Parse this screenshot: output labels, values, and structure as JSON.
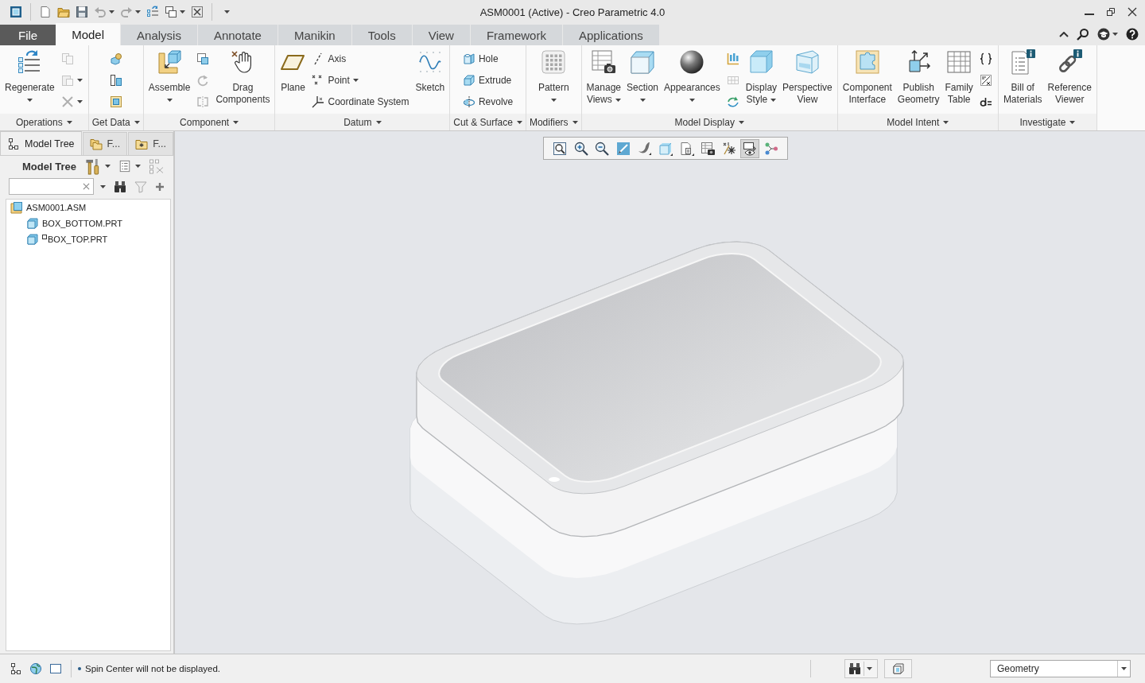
{
  "window": {
    "title": "ASM0001 (Active) - Creo Parametric 4.0"
  },
  "quick_access": [
    {
      "disabled": false,
      "dropdown": false
    },
    {
      "disabled": false,
      "dropdown": false
    },
    {
      "disabled": false,
      "dropdown": false
    },
    {
      "disabled": true,
      "dropdown": true
    },
    {
      "disabled": true,
      "dropdown": true
    },
    {
      "disabled": false,
      "dropdown": false
    },
    {
      "disabled": false,
      "dropdown": true
    },
    {
      "disabled": false,
      "dropdown": false
    }
  ],
  "tabs": [
    {
      "label": "File",
      "kind": "file",
      "selected": false
    },
    {
      "label": "Model",
      "kind": "tab",
      "selected": true
    },
    {
      "label": "Analysis",
      "kind": "tab",
      "selected": false
    },
    {
      "label": "Annotate",
      "kind": "tab",
      "selected": false
    },
    {
      "label": "Manikin",
      "kind": "tab",
      "selected": false
    },
    {
      "label": "Tools",
      "kind": "tab",
      "selected": false
    },
    {
      "label": "View",
      "kind": "tab",
      "selected": false
    },
    {
      "label": "Framework",
      "kind": "tab",
      "selected": false
    },
    {
      "label": "Applications",
      "kind": "tab",
      "selected": false
    }
  ],
  "ribbon": {
    "groups": [
      {
        "label": "Operations",
        "columns": [
          {
            "kind": "large",
            "label": "Regenerate",
            "dropdown": true
          },
          {
            "kind": "stack",
            "items": [
              {
                "disabled": true,
                "dropdown": false
              },
              {
                "disabled": true,
                "dropdown": true
              },
              {
                "disabled": true,
                "dropdown": true
              }
            ]
          }
        ]
      },
      {
        "label": "Get Data",
        "columns": [
          {
            "kind": "stack",
            "items": [
              {
                "disabled": false,
                "dropdown": false
              },
              {
                "disabled": false,
                "dropdown": false
              },
              {
                "disabled": false,
                "dropdown": false
              }
            ]
          }
        ]
      },
      {
        "label": "Component",
        "columns": [
          {
            "kind": "large",
            "label": "Assemble",
            "dropdown": true
          },
          {
            "kind": "stack",
            "items": [
              {
                "disabled": false,
                "dropdown": false
              },
              {
                "disabled": true,
                "dropdown": false
              },
              {
                "disabled": true,
                "dropdown": false
              }
            ]
          },
          {
            "kind": "large",
            "label": "Drag Components",
            "dropdown": false
          }
        ]
      },
      {
        "label": "Datum",
        "columns": [
          {
            "kind": "large",
            "label": "Plane",
            "dropdown": false
          },
          {
            "kind": "stack",
            "items": [
              {
                "label": "Axis",
                "disabled": false,
                "dropdown": false
              },
              {
                "label": "Point",
                "disabled": false,
                "dropdown": true
              },
              {
                "label": "Coordinate System",
                "disabled": false,
                "dropdown": false
              }
            ]
          },
          {
            "kind": "large",
            "label": "Sketch",
            "dropdown": false
          }
        ]
      },
      {
        "label": "Cut & Surface",
        "columns": [
          {
            "kind": "stack",
            "items": [
              {
                "label": "Hole",
                "disabled": false,
                "dropdown": false
              },
              {
                "label": "Extrude",
                "disabled": false,
                "dropdown": false
              },
              {
                "label": "Revolve",
                "disabled": false,
                "dropdown": false
              }
            ]
          }
        ]
      },
      {
        "label": "Modifiers",
        "columns": [
          {
            "kind": "large",
            "label": "Pattern",
            "dropdown": true
          }
        ]
      },
      {
        "label": "Model Display",
        "columns": [
          {
            "kind": "large",
            "label": "Manage Views",
            "dropdown": true
          },
          {
            "kind": "large",
            "label": "Section",
            "dropdown": true
          },
          {
            "kind": "large",
            "label": "Appearances",
            "dropdown": true
          },
          {
            "kind": "stack",
            "items": [
              {
                "disabled": false,
                "dropdown": false
              },
              {
                "disabled": true,
                "dropdown": false
              },
              {
                "disabled": false,
                "dropdown": false
              }
            ]
          },
          {
            "kind": "large",
            "label": "Display Style",
            "dropdown": true
          },
          {
            "kind": "large",
            "label": "Perspective View",
            "dropdown": false
          }
        ]
      },
      {
        "label": "Model Intent",
        "columns": [
          {
            "kind": "large",
            "label": "Component Interface",
            "dropdown": false
          },
          {
            "kind": "large",
            "label": "Publish Geometry",
            "dropdown": false
          },
          {
            "kind": "large",
            "label": "Family Table",
            "dropdown": false
          },
          {
            "kind": "stack",
            "items": [
              {
                "disabled": false,
                "dropdown": false
              },
              {
                "disabled": false,
                "dropdown": false
              },
              {
                "disabled": false,
                "dropdown": false
              }
            ]
          }
        ]
      },
      {
        "label": "Investigate",
        "columns": [
          {
            "kind": "large",
            "label": "Bill of Materials",
            "dropdown": false
          },
          {
            "kind": "large",
            "label": "Reference Viewer",
            "dropdown": false
          }
        ]
      }
    ]
  },
  "left_panel": {
    "tabs": [
      {
        "label": "Model Tree",
        "selected": true
      },
      {
        "label": "F...",
        "selected": false
      },
      {
        "label": "F...",
        "selected": false
      }
    ],
    "title": "Model Tree",
    "tree": [
      {
        "label": "ASM0001.ASM",
        "kind": "assembly",
        "flagged": false,
        "children": [
          {
            "label": "BOX_BOTTOM.PRT",
            "kind": "part",
            "flagged": false
          },
          {
            "label": "BOX_TOP.PRT",
            "kind": "part",
            "flagged": true
          }
        ]
      }
    ]
  },
  "view_toolbar": [
    {
      "on": false
    },
    {
      "on": false
    },
    {
      "on": false
    },
    {
      "on": false
    },
    {
      "on": false
    },
    {
      "on": false
    },
    {
      "on": false
    },
    {
      "on": false
    },
    {
      "on": false
    },
    {
      "on": true
    },
    {
      "on": false
    }
  ],
  "status_bar": {
    "message": "Spin Center will not be displayed.",
    "filter": "Geometry"
  }
}
